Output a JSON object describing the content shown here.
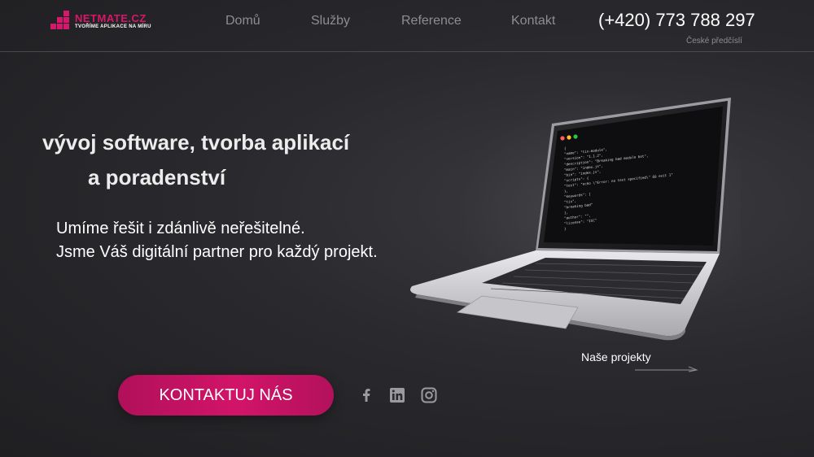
{
  "logo": {
    "title": "NETMATE.CZ",
    "tagline": "TVOŘÍME APLIKACE NA MÍRU"
  },
  "nav": {
    "items": [
      {
        "label": "Domů"
      },
      {
        "label": "Služby"
      },
      {
        "label": "Reference"
      },
      {
        "label": "Kontakt"
      }
    ]
  },
  "contact": {
    "phone": "(+420) 773 788 297",
    "phone_note": "České předčíslí"
  },
  "hero": {
    "headline_line1": "vývoj software, tvorba aplikací",
    "headline_line2": "a poradenství",
    "subline1": "Umíme řešit i zdánlivě neřešitelné.",
    "subline2": "Jsme Váš digitální partner pro každý projekt.",
    "cta_label": "KONTAKTUJ NÁS",
    "projects_link": "Naše projekty"
  },
  "social": [
    {
      "icon": "facebook-icon"
    },
    {
      "icon": "linkedin-icon"
    },
    {
      "icon": "instagram-icon"
    }
  ],
  "laptop_code": [
    "{",
    "  \"name\": \"tix-module\",",
    "  \"version\": \"1.1.2\",",
    "  \"description\": \"Breaking bad module bot\",",
    "  \"main\": \"index.js\",",
    "  \"bin\": \"index.js\",",
    "  \"scripts\": {",
    "    \"test\": \"echo \\\"Error: no test specified\\\" && exit 1\"",
    "  },",
    "  \"keywords\": [",
    "    \"tix\",",
    "    \"breaking bad\"",
    "  ],",
    "  \"author\": \"\",",
    "  \"license\": \"ISC\"",
    "}"
  ],
  "colors": {
    "accent": "#d6176b",
    "background": "#2a2a2e",
    "nav_text": "#8d8d92"
  }
}
